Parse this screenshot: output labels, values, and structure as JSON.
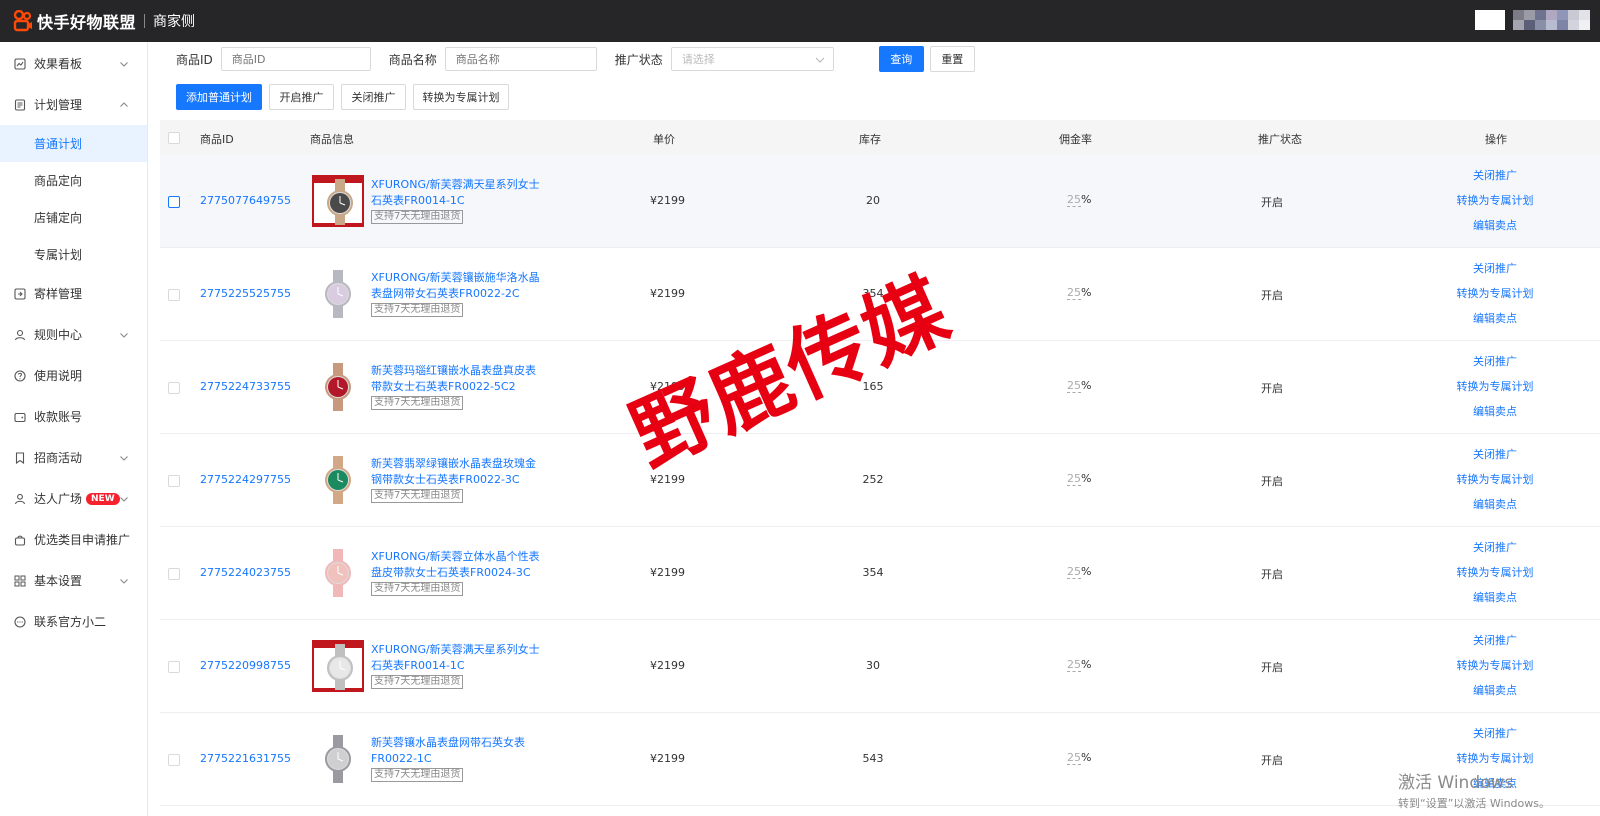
{
  "header": {
    "brand": "快手好物联盟",
    "sub": "商家侧",
    "logo_color": "#ff4906"
  },
  "sidebar": {
    "items": [
      {
        "label": "效果看板",
        "icon": "chart-icon",
        "chevron": "down"
      },
      {
        "label": "计划管理",
        "icon": "plan-icon",
        "chevron": "up",
        "children": [
          "普通计划",
          "商品定向",
          "店铺定向",
          "专属计划"
        ],
        "active_child": 0
      },
      {
        "label": "寄样管理",
        "icon": "sample-icon",
        "chevron": ""
      },
      {
        "label": "规则中心",
        "icon": "rules-icon",
        "chevron": "down"
      },
      {
        "label": "使用说明",
        "icon": "help-icon",
        "chevron": ""
      },
      {
        "label": "收款账号",
        "icon": "wallet-icon",
        "chevron": ""
      },
      {
        "label": "招商活动",
        "icon": "bookmark-icon",
        "chevron": "down"
      },
      {
        "label": "达人广场",
        "icon": "user-icon",
        "chevron": "down",
        "badge": "NEW"
      },
      {
        "label": "优选类目申请推广",
        "icon": "bag-icon",
        "chevron": ""
      },
      {
        "label": "基本设置",
        "icon": "grid-icon",
        "chevron": "down"
      },
      {
        "label": "联系官方小二",
        "icon": "chat-icon",
        "chevron": ""
      }
    ]
  },
  "filters": {
    "id_label": "商品ID",
    "id_placeholder": "商品ID",
    "name_label": "商品名称",
    "name_placeholder": "商品名称",
    "status_label": "推广状态",
    "status_placeholder": "请选择",
    "query": "查询",
    "reset": "重置"
  },
  "actions": {
    "add": "添加普通计划",
    "enable": "开启推广",
    "disable": "关闭推广",
    "convert": "转换为专属计划"
  },
  "table": {
    "headers": {
      "id": "商品ID",
      "info": "商品信息",
      "price": "单价",
      "stock": "库存",
      "rate": "佣金率",
      "status": "推广状态",
      "ops": "操作"
    },
    "rows": [
      {
        "id": "2775077649755",
        "name": "XFURONG/新芙蓉满天星系列女士石英表FR0014-1C",
        "tag": "支持7天无理由退货",
        "price": "¥2199",
        "stock": "20",
        "rate": "25",
        "unit": "%",
        "status": "开启",
        "thumb": "boxed",
        "face": "#4a4a4a",
        "band": "#c8a888",
        "highlight": true
      },
      {
        "id": "2775225525755",
        "name": "XFURONG/新芙蓉镶嵌施华洛水晶表盘网带女石英表FR0022-2C",
        "tag": "支持7天无理由退货",
        "price": "¥2199",
        "stock": "354",
        "rate": "25",
        "unit": "%",
        "status": "开启",
        "thumb": "plain",
        "face": "#d9cce0",
        "band": "#b8b8c0",
        "highlight": false
      },
      {
        "id": "2775224733755",
        "name": "新芙蓉玛瑙红镶嵌水晶表盘真皮表带款女士石英表FR0022-5C2",
        "tag": "支持7天无理由退货",
        "price": "¥2199",
        "stock": "165",
        "rate": "25",
        "unit": "%",
        "status": "开启",
        "thumb": "plain",
        "face": "#b3172a",
        "band": "#c79a7e",
        "highlight": false
      },
      {
        "id": "2775224297755",
        "name": "新芙蓉翡翠绿镶嵌水晶表盘玫瑰金钢带款女士石英表FR0022-3C",
        "tag": "支持7天无理由退货",
        "price": "¥2199",
        "stock": "252",
        "rate": "25",
        "unit": "%",
        "status": "开启",
        "thumb": "plain",
        "face": "#1b8a5e",
        "band": "#d2a886",
        "highlight": false
      },
      {
        "id": "2775224023755",
        "name": "XFURONG/新芙蓉立体水晶个性表盘皮带款女士石英表FR0024-3C",
        "tag": "支持7天无理由退货",
        "price": "¥2199",
        "stock": "354",
        "rate": "25",
        "unit": "%",
        "status": "开启",
        "thumb": "plain",
        "face": "#f1c2bd",
        "band": "#f0b8b8",
        "highlight": false
      },
      {
        "id": "2775220998755",
        "name": "XFURONG/新芙蓉满天星系列女士石英表FR0014-1C",
        "tag": "支持7天无理由退货",
        "price": "¥2199",
        "stock": "30",
        "rate": "25",
        "unit": "%",
        "status": "开启",
        "thumb": "boxed",
        "face": "#e8e8e8",
        "band": "#c0c0c0",
        "highlight": false
      },
      {
        "id": "2775221631755",
        "name": "新芙蓉镶水晶表盘网带石英女表FR0022-1C",
        "tag": "支持7天无理由退货",
        "price": "¥2199",
        "stock": "543",
        "rate": "25",
        "unit": "%",
        "status": "开启",
        "thumb": "plain",
        "face": "#cfcfd2",
        "band": "#9a9aa0",
        "highlight": false
      }
    ],
    "ops": [
      "关闭推广",
      "转换为专属计划",
      "编辑卖点"
    ]
  },
  "watermark": "野鹿传媒",
  "activation": {
    "line1": "激活 Windows",
    "line2": "转到“设置”以激活 Windows。"
  }
}
